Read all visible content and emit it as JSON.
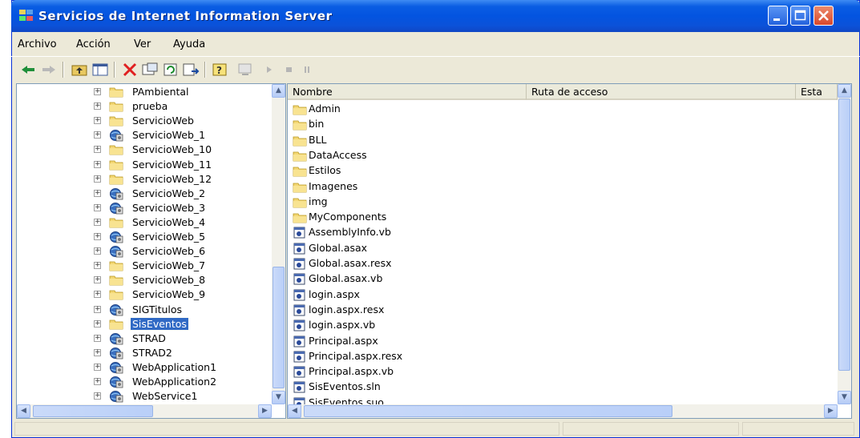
{
  "window": {
    "title": "Servicios de Internet Information Server"
  },
  "menu": [
    "Archivo",
    "Acción",
    "Ver",
    "Ayuda"
  ],
  "toolbar": {
    "buttons": [
      "back-arrow",
      "forward-arrow",
      "up-folder",
      "show-hide-tree",
      "delete",
      "properties",
      "refresh",
      "export-list",
      "help",
      "computer",
      "play",
      "stop",
      "pause"
    ]
  },
  "tree": {
    "items": [
      {
        "label": "PAmbiental",
        "icon": "folder"
      },
      {
        "label": "prueba",
        "icon": "folder"
      },
      {
        "label": "ServicioWeb",
        "icon": "folder"
      },
      {
        "label": "ServicioWeb_1",
        "icon": "web-app"
      },
      {
        "label": "ServicioWeb_10",
        "icon": "folder"
      },
      {
        "label": "ServicioWeb_11",
        "icon": "folder"
      },
      {
        "label": "ServicioWeb_12",
        "icon": "folder"
      },
      {
        "label": "ServicioWeb_2",
        "icon": "web-app"
      },
      {
        "label": "ServicioWeb_3",
        "icon": "web-app"
      },
      {
        "label": "ServicioWeb_4",
        "icon": "folder"
      },
      {
        "label": "ServicioWeb_5",
        "icon": "web-app"
      },
      {
        "label": "ServicioWeb_6",
        "icon": "web-app"
      },
      {
        "label": "ServicioWeb_7",
        "icon": "folder"
      },
      {
        "label": "ServicioWeb_8",
        "icon": "folder"
      },
      {
        "label": "ServicioWeb_9",
        "icon": "folder"
      },
      {
        "label": "SIGTitulos",
        "icon": "web-app"
      },
      {
        "label": "SisEventos",
        "icon": "folder",
        "selected": true
      },
      {
        "label": "STRAD",
        "icon": "web-app"
      },
      {
        "label": "STRAD2",
        "icon": "web-app"
      },
      {
        "label": "WebApplication1",
        "icon": "web-app"
      },
      {
        "label": "WebApplication2",
        "icon": "web-app"
      },
      {
        "label": "WebService1",
        "icon": "web-app"
      }
    ]
  },
  "list": {
    "columns": [
      "Nombre",
      "Ruta de acceso",
      "Esta"
    ],
    "items": [
      {
        "name": "Admin",
        "icon": "folder"
      },
      {
        "name": "bin",
        "icon": "folder"
      },
      {
        "name": "BLL",
        "icon": "folder"
      },
      {
        "name": "DataAccess",
        "icon": "folder"
      },
      {
        "name": "Estilos",
        "icon": "folder"
      },
      {
        "name": "Imagenes",
        "icon": "folder"
      },
      {
        "name": "img",
        "icon": "folder"
      },
      {
        "name": "MyComponents",
        "icon": "folder"
      },
      {
        "name": "AssemblyInfo.vb",
        "icon": "file"
      },
      {
        "name": "Global.asax",
        "icon": "file"
      },
      {
        "name": "Global.asax.resx",
        "icon": "file"
      },
      {
        "name": "Global.asax.vb",
        "icon": "file"
      },
      {
        "name": "login.aspx",
        "icon": "file"
      },
      {
        "name": "login.aspx.resx",
        "icon": "file"
      },
      {
        "name": "login.aspx.vb",
        "icon": "file"
      },
      {
        "name": "Principal.aspx",
        "icon": "file"
      },
      {
        "name": "Principal.aspx.resx",
        "icon": "file"
      },
      {
        "name": "Principal.aspx.vb",
        "icon": "file"
      },
      {
        "name": "SisEventos.sln",
        "icon": "file"
      },
      {
        "name": "SisEventos.suo",
        "icon": "file"
      }
    ]
  }
}
